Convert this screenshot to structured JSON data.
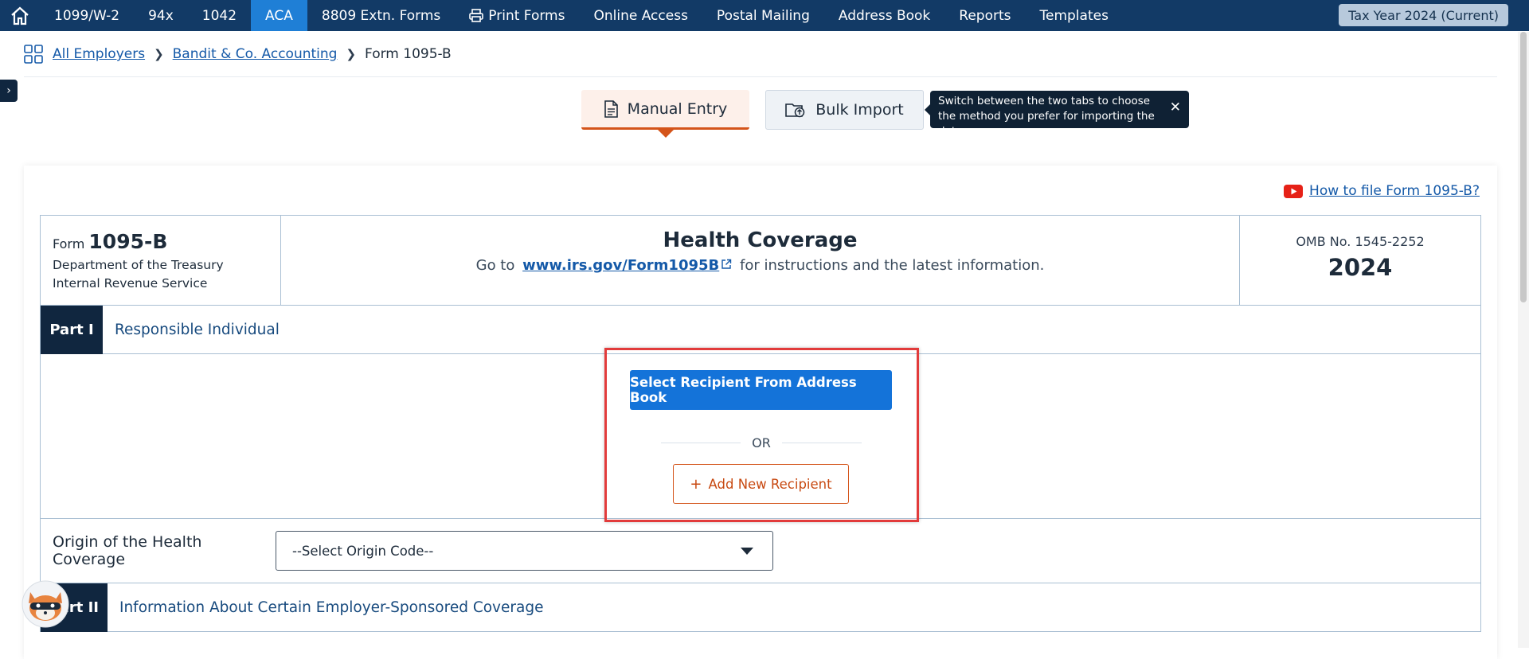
{
  "nav": {
    "items": [
      {
        "label": "1099/W-2"
      },
      {
        "label": "94x"
      },
      {
        "label": "1042"
      },
      {
        "label": "ACA"
      },
      {
        "label": "8809 Extn. Forms"
      },
      {
        "label": "Print Forms"
      },
      {
        "label": "Online Access"
      },
      {
        "label": "Postal Mailing"
      },
      {
        "label": "Address Book"
      },
      {
        "label": "Reports"
      },
      {
        "label": "Templates"
      }
    ],
    "active": "ACA",
    "tax_year": "Tax Year 2024 (Current)"
  },
  "breadcrumb": {
    "all_employers": "All Employers",
    "employer": "Bandit & Co. Accounting",
    "current": "Form 1095-B"
  },
  "tabs": {
    "manual": "Manual Entry",
    "bulk": "Bulk Import",
    "tooltip": "Switch between the two tabs to choose the method you prefer for importing the data."
  },
  "howto": "How to file Form 1095-B?",
  "form": {
    "form_word": "Form",
    "form_number": "1095-B",
    "dept_line1": "Department of the Treasury",
    "dept_line2": "Internal Revenue Service",
    "title": "Health Coverage",
    "goto_prefix": "Go to",
    "irs_link": "www.irs.gov/Form1095B",
    "goto_suffix": "for instructions and the latest information.",
    "omb": "OMB No. 1545-2252",
    "year": "2024"
  },
  "part1": {
    "tag": "Part I",
    "title": "Responsible Individual"
  },
  "recipient": {
    "select_button": "Select Recipient From Address Book",
    "or": "OR",
    "add_button": "Add New Recipient"
  },
  "origin": {
    "label": "Origin of the Health Coverage",
    "placeholder": "--Select Origin Code--"
  },
  "part2": {
    "tag": "Part II",
    "title": "Information About Certain Employer-Sponsored Coverage"
  },
  "colors": {
    "nav_bg": "#123a66",
    "active_tab": "#1f7fd6",
    "accent_orange": "#d4541a",
    "primary_blue": "#1473d9",
    "highlight_red": "#e23b3b"
  }
}
